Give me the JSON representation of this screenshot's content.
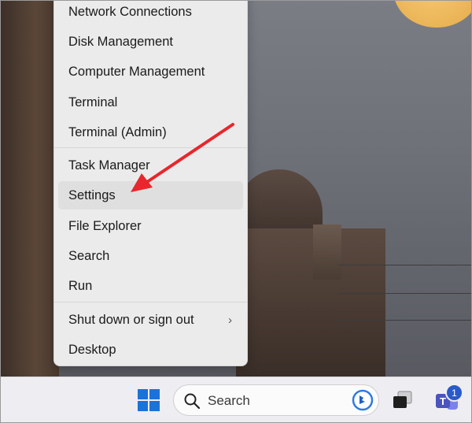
{
  "menu": {
    "items": [
      {
        "label": "Network Connections"
      },
      {
        "label": "Disk Management"
      },
      {
        "label": "Computer Management"
      },
      {
        "label": "Terminal"
      },
      {
        "label": "Terminal (Admin)"
      },
      {
        "label": "Task Manager"
      },
      {
        "label": "Settings"
      },
      {
        "label": "File Explorer"
      },
      {
        "label": "Search"
      },
      {
        "label": "Run"
      },
      {
        "label": "Shut down or sign out"
      },
      {
        "label": "Desktop"
      }
    ],
    "hovered_item": "Settings"
  },
  "taskbar": {
    "search_label": "Search",
    "teams_badge": "1",
    "icons": [
      "windows-start-icon",
      "search-icon",
      "bing-icon",
      "task-view-icon",
      "teams-icon"
    ]
  },
  "colors": {
    "annotation_arrow": "#e8262d",
    "taskbar": "#eeedf1",
    "menu": "#ecebeb",
    "start_blue": "#1a73d9"
  }
}
